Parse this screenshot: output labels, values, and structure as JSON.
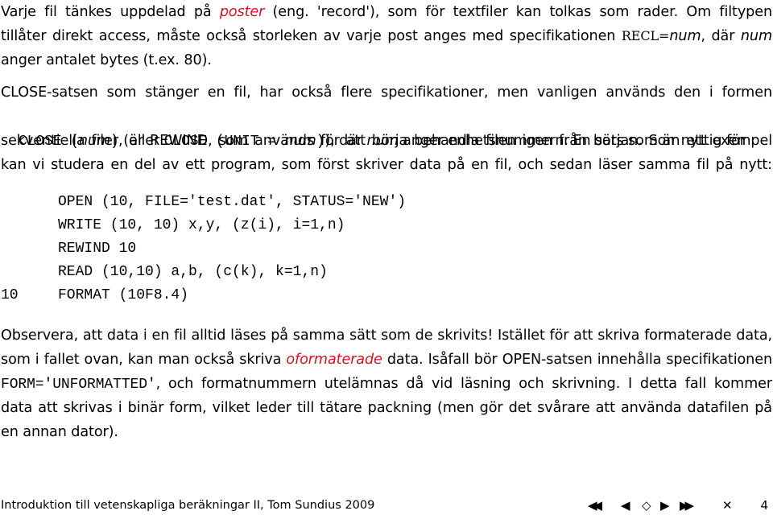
{
  "paragraph1": {
    "line1": {
      "pre": "Varje fil tänkes uppdelad på ",
      "red": "poster",
      "post": " (eng. 'record'), som för textfiler kan tolkas som rader. Om filtypen"
    },
    "line2": {
      "pre": "tillåter direkt access, måste också storleken av varje post anges med specifikationen ",
      "code": "RECL=",
      "it1": "num",
      "mid": ", där ",
      "it2": "num"
    },
    "line3": "anger antalet bytes (t.ex. 80)."
  },
  "paragraph2": {
    "line1": "CLOSE-satsen som stänger en fil, har också flere specifikationer, men vanligen används den i formen",
    "line2": {
      "code1": "CLOSE (",
      "it1": "num",
      "code1b": ")",
      "mid1": " (eller ",
      "code2": "CLOSE (UNIT = ",
      "it2": "num",
      "code2b": ")",
      "mid2": "), där ",
      "it3": "num",
      "post": " anger enhetsnummern. En sats som är nyttig för"
    },
    "line3": "sekventiella filer, är REWIND, som används för att börja behandla filen igen från början. Som ett exempel",
    "line4": "kan vi studera en del av ett program, som först skriver data på en fil, och sedan läser samma fil på nytt:"
  },
  "code_block": {
    "lines": [
      {
        "label": "",
        "code": "OPEN (10, FILE='test.dat', STATUS='NEW')"
      },
      {
        "label": "",
        "code": "WRITE (10, 10) x,y, (z(i), i=1,n)"
      },
      {
        "label": "",
        "code": "REWIND 10"
      },
      {
        "label": "",
        "code": "READ (10,10) a,b, (c(k), k=1,n)"
      },
      {
        "label": "10",
        "code": "FORMAT (10F8.4)"
      }
    ]
  },
  "paragraph3": {
    "line1": "Observera, att data i en fil alltid läses på samma sätt som de skrivits! Istället för att skriva formaterade data,",
    "line2": {
      "pre": "som i fallet ovan, kan man också skriva ",
      "red": "oformaterade",
      "post": " data. Isåfall bör OPEN-satsen innehålla specifikationen"
    },
    "line3": {
      "code": "FORM='UNFORMATTED'",
      "post": ", och formatnummern utelämnas då vid läsning och skrivning. I detta fall kommer"
    },
    "line4": "data att skrivas i binär form, vilket leder till tätare packning (men gör det svårare att använda datafilen på",
    "line5": "en annan dator)."
  },
  "footer": {
    "title": "Introduktion till vetenskapliga beräkningar II, Tom Sundius 2009",
    "nav": {
      "first": "◀◀",
      "prev": "◀",
      "back": "◇",
      "next": "▶",
      "last": "▶▶",
      "close": "✕"
    },
    "page": "4"
  },
  "colors": {
    "emphasis": "#d8121e",
    "text": "#000000"
  }
}
